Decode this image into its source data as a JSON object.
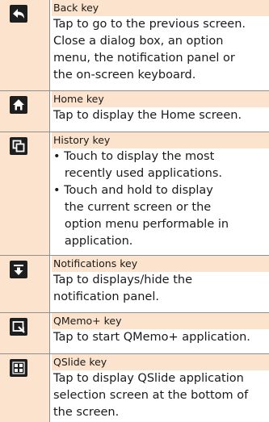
{
  "keys": [
    {
      "icon": "back-arrow-icon",
      "title": "Back key",
      "lines": [
        "Tap to go to the previous screen.",
        "Close a dialog box, an option",
        "menu, the notification panel or",
        "the on-screen keyboard."
      ]
    },
    {
      "icon": "home-icon",
      "title": "Home key",
      "lines": [
        "Tap to display the Home screen."
      ]
    },
    {
      "icon": "history-icon",
      "title": "History key",
      "lines": [
        "• Touch to display the most",
        "   recently used applications.",
        "• Touch and hold to display",
        "   the current screen or the",
        "   option menu performable in",
        "   application."
      ]
    },
    {
      "icon": "notifications-icon",
      "title": "Notifications key",
      "lines": [
        "Tap to displays/hide the",
        "notification panel."
      ]
    },
    {
      "icon": "qmemo-icon",
      "title": "QMemo+ key",
      "lines": [
        "Tap to start QMemo+ application."
      ]
    },
    {
      "icon": "qslide-icon",
      "title": "QSlide key",
      "lines": [
        "Tap to display QSlide application",
        "selection screen at the bottom of",
        "the screen."
      ]
    }
  ]
}
